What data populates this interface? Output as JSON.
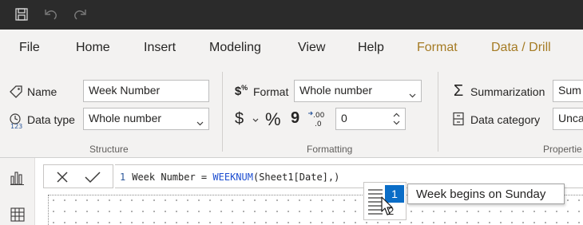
{
  "menu": {
    "tabs": [
      "File",
      "Home",
      "Insert",
      "Modeling",
      "View",
      "Help",
      "Format",
      "Data / Drill"
    ]
  },
  "ribbon": {
    "structure": {
      "name_label": "Name",
      "name_value": "Week Number",
      "datatype_label": "Data type",
      "datatype_value": "Whole number",
      "group_label": "Structure"
    },
    "formatting": {
      "format_label": "Format",
      "format_value": "Whole number",
      "decimal_value": "0",
      "group_label": "Formatting",
      "currency_symbol": "$",
      "percent_symbol": "%",
      "comma_symbol": "9"
    },
    "properties": {
      "summarization_label": "Summarization",
      "summarization_value": "Sum",
      "datacategory_label": "Data category",
      "datacategory_value": "Unca",
      "group_label": "Propertie"
    }
  },
  "formula": {
    "line_number": "1",
    "prefix": "Week Number = ",
    "function": "WEEKNUM",
    "args": "(Sheet1[Date],)"
  },
  "suggestion": {
    "selected": "1",
    "next": "2",
    "tooltip": "Week begins on Sunday"
  },
  "colors": {
    "titlebar": "#2b2b2b",
    "context_tab": "#a57b24",
    "selection": "#0a6dc7",
    "dax_function": "#1f4fd1"
  }
}
